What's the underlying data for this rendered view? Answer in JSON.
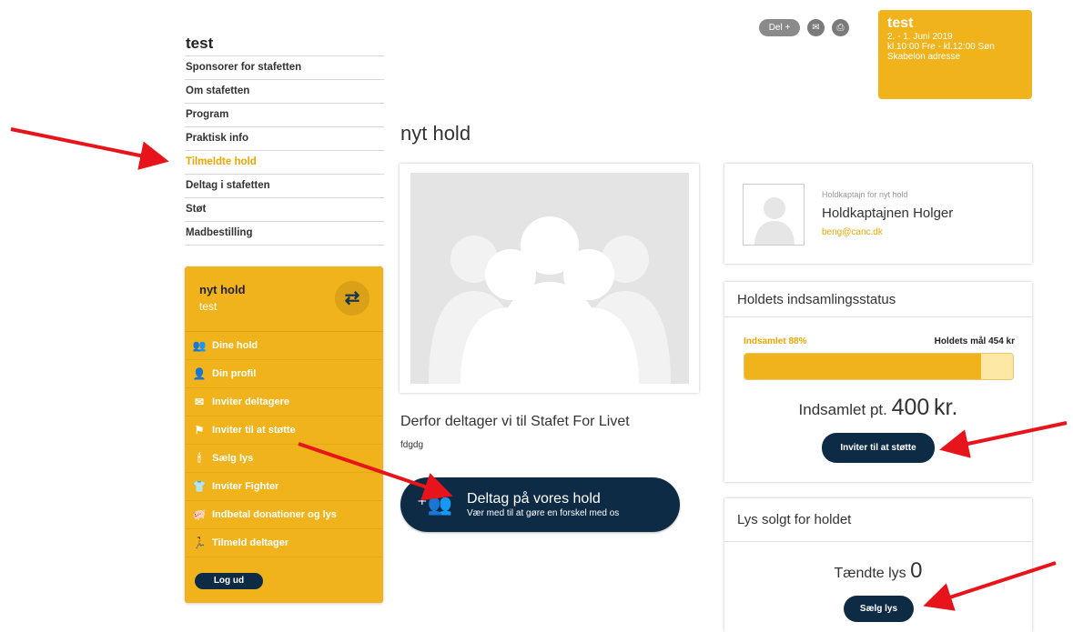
{
  "site": {
    "title": "test"
  },
  "nav": {
    "items": [
      {
        "label": "Sponsorer for stafetten",
        "active": false
      },
      {
        "label": "Om stafetten",
        "active": false
      },
      {
        "label": "Program",
        "active": false
      },
      {
        "label": "Praktisk info",
        "active": false
      },
      {
        "label": "Tilmeldte hold",
        "active": true
      },
      {
        "label": "Deltag i stafetten",
        "active": false
      },
      {
        "label": "Støt",
        "active": false
      },
      {
        "label": "Madbestilling",
        "active": false
      }
    ]
  },
  "team_panel": {
    "name": "nyt hold",
    "sub": "test",
    "swap_icon": "swap-arrows-icon",
    "menu": [
      {
        "label": "Dine hold",
        "icon": "group-icon",
        "glyph": "👥"
      },
      {
        "label": "Din profil",
        "icon": "person-icon",
        "glyph": "👤"
      },
      {
        "label": "Inviter deltagere",
        "icon": "envelope-icon",
        "glyph": "✉"
      },
      {
        "label": "Inviter til at støtte",
        "icon": "flag-icon",
        "glyph": "⚑"
      },
      {
        "label": "Sælg lys",
        "icon": "candle-icon",
        "glyph": "🕯"
      },
      {
        "label": "Inviter Fighter",
        "icon": "shirt-icon",
        "glyph": "👕"
      },
      {
        "label": "Indbetal donationer og lys",
        "icon": "piggy-bank-icon",
        "glyph": "🐖"
      },
      {
        "label": "Tilmeld deltager",
        "icon": "runner-icon",
        "glyph": "🏃"
      }
    ],
    "logout": "Log ud"
  },
  "header": {
    "share": "Del +",
    "mail_icon": "mail-icon",
    "print_icon": "print-icon"
  },
  "event": {
    "title": "test",
    "date": "2. - 1. Juni 2019",
    "time": "kl.10:00 Fre - kl.12:00 Søn",
    "address": "Skabelon adresse"
  },
  "main": {
    "title": "nyt hold",
    "why_title": "Derfor deltager vi til Stafet For Livet",
    "why_text": "fdgdg",
    "join_button": {
      "main": "Deltag på vores hold",
      "sub": "Vær med til at gøre en forskel med os"
    }
  },
  "captain": {
    "label": "Holdkaptajn for nyt hold",
    "name": "Holdkaptajnen Holger",
    "email": "beng@canc.dk"
  },
  "status": {
    "title": "Holdets indsamlingsstatus",
    "collected_label": "Indsamlet 88%",
    "goal_label": "Holdets mål 454 kr",
    "progress_fraction": 0.88,
    "collected_prefix": "Indsamlet pt.",
    "collected_amount": "400",
    "collected_unit": "kr.",
    "support_button": "Inviter til at støtte"
  },
  "lights": {
    "title": "Lys solgt for holdet",
    "count_label": "Tændte lys",
    "count": "0",
    "buy_button": "Sælg lys"
  },
  "colors": {
    "accent": "#f0b31b",
    "navy": "#0e2b45",
    "arrow": "#e8141b"
  }
}
